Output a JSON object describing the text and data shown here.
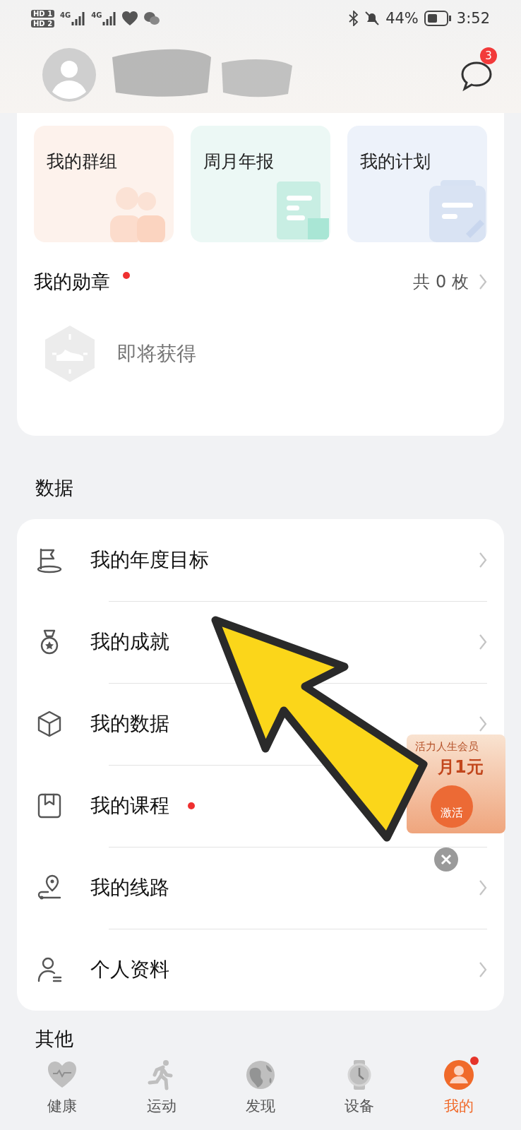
{
  "status_bar": {
    "sims": [
      "HD 1",
      "HD 2"
    ],
    "networks": [
      "4G",
      "4G"
    ],
    "battery": "44%",
    "time": "3:52"
  },
  "header": {
    "notification_count": "3"
  },
  "shortcuts": [
    {
      "label": "我的群组",
      "kind": "group"
    },
    {
      "label": "周月年报",
      "kind": "report"
    },
    {
      "label": "我的计划",
      "kind": "plan"
    }
  ],
  "medals": {
    "title": "我的勋章",
    "new": true,
    "count": "共 0 枚",
    "upcoming": "即将获得"
  },
  "data_section": {
    "title": "数据",
    "items": [
      {
        "label": "我的年度目标",
        "kind": "flag",
        "new": false
      },
      {
        "label": "我的成就",
        "kind": "medal",
        "new": false
      },
      {
        "label": "我的数据",
        "kind": "cube",
        "new": false
      },
      {
        "label": "我的课程",
        "kind": "book",
        "new": true
      },
      {
        "label": "我的线路",
        "kind": "route",
        "new": false
      },
      {
        "label": "个人资料",
        "kind": "person",
        "new": false
      }
    ]
  },
  "promo": {
    "title": "活力人生会员",
    "price": "月1元",
    "action": "激活"
  },
  "other_section": {
    "title": "其他"
  },
  "tab_bar": [
    {
      "label": "健康",
      "kind": "heart",
      "selected": false,
      "badge": false
    },
    {
      "label": "运动",
      "kind": "run",
      "selected": false,
      "badge": false
    },
    {
      "label": "发现",
      "kind": "globe",
      "selected": false,
      "badge": false
    },
    {
      "label": "设备",
      "kind": "watch",
      "selected": false,
      "badge": false
    },
    {
      "label": "我的",
      "kind": "user",
      "selected": true,
      "badge": true
    }
  ]
}
